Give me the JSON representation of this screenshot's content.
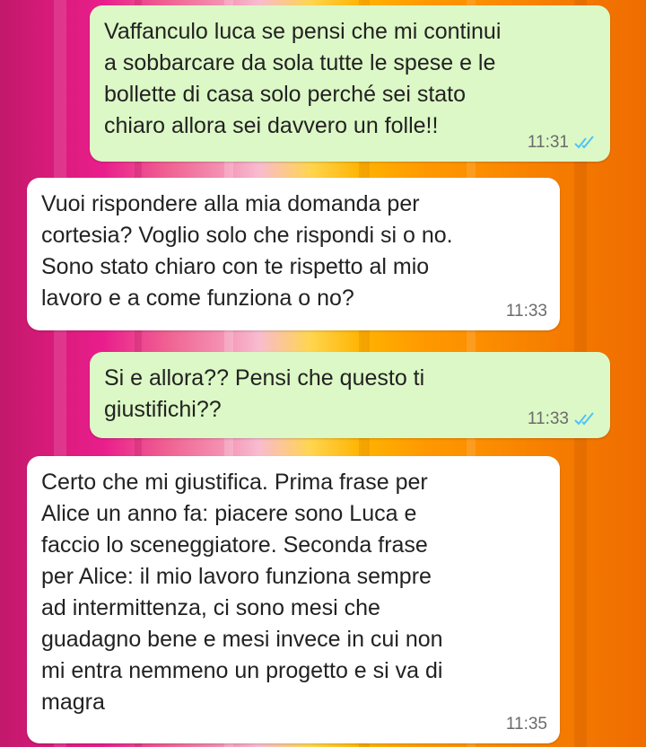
{
  "theme": {
    "outgoing_bubble": "#dcf8c6",
    "incoming_bubble": "#ffffff",
    "read_tick_color": "#4fc3f7"
  },
  "messages": [
    {
      "direction": "outgoing",
      "text": "Vaffanculo luca se pensi che mi continui\na sobbarcare da sola tutte le spese e le\nbollette di casa solo perché sei stato\nchiaro allora sei davvero un folle!!",
      "time": "11:31",
      "status_icon": "double-check-read-icon"
    },
    {
      "direction": "incoming",
      "text": "Vuoi rispondere alla mia domanda per\ncortesia? Voglio solo che rispondi si o no.\nSono stato chiaro con te rispetto al mio\nlavoro e a come funziona o no?",
      "time": "11:33"
    },
    {
      "direction": "outgoing",
      "text": "Si e allora?? Pensi che questo ti\ngiustifichi??",
      "time": "11:33",
      "status_icon": "double-check-read-icon"
    },
    {
      "direction": "incoming",
      "text": "Certo che mi giustifica. Prima frase per\nAlice un anno fa: piacere sono Luca e\nfaccio lo sceneggiatore. Seconda frase\nper Alice: il mio lavoro funziona sempre\nad intermittenza, ci sono mesi che\nguadagno bene e mesi invece in cui non\nmi entra nemmeno un progetto e si va di\nmagra",
      "time": "11:35"
    }
  ]
}
